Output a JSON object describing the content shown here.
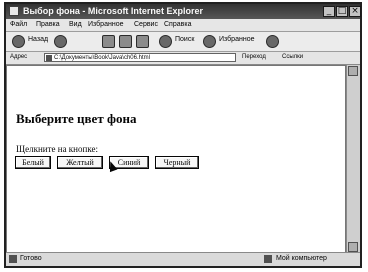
{
  "window": {
    "title": "Выбор фона - Microsoft Internet Explorer"
  },
  "menubar": {
    "items": [
      "Файл",
      "Правка",
      "Вид",
      "Избранное",
      "Сервис",
      "Справка"
    ]
  },
  "toolbar": {
    "back_label": "Назад",
    "search_label": "Поиск",
    "favorites_label": "Избранное"
  },
  "addressbar": {
    "label": "Адрес",
    "url": "C:\\Документы\\Book\\Java\\ch06.html",
    "go_label": "Переход",
    "links_label": "Ссылки"
  },
  "content": {
    "heading": "Выберите цвет фона",
    "prompt": "Щелкните на кнопке:",
    "buttons": [
      "Белый",
      "Желтый",
      "Синий",
      "Черный"
    ]
  },
  "statusbar": {
    "left_text": "Готово",
    "zone_text": "Мой компьютер"
  },
  "icons": [
    "app-icon",
    "back-icon",
    "forward-icon",
    "stop-icon",
    "refresh-icon",
    "home-icon",
    "search-icon",
    "favorites-icon",
    "media-icon",
    "page-icon",
    "cursor-icon"
  ]
}
